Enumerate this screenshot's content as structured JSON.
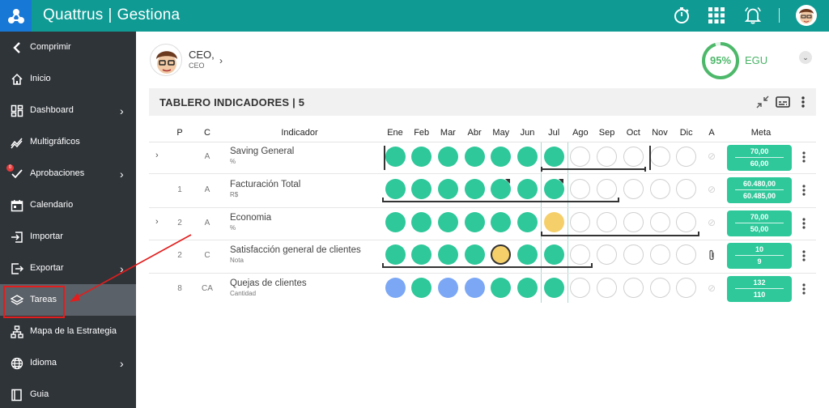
{
  "app": {
    "title_left": "Quattrus",
    "title_right": "Gestiona",
    "title_sep": "|"
  },
  "sidebar": {
    "items": [
      {
        "label": "Comprimir",
        "icon": "chevron-left-icon"
      },
      {
        "label": "Inicio",
        "icon": "home-icon"
      },
      {
        "label": "Dashboard",
        "icon": "dashboard-icon",
        "has_submenu": true
      },
      {
        "label": "Multigráficos",
        "icon": "trend-icon"
      },
      {
        "label": "Aprobaciones",
        "icon": "check-edit-icon",
        "has_submenu": true,
        "badge": "0"
      },
      {
        "label": "Calendario",
        "icon": "calendar-icon"
      },
      {
        "label": "Importar",
        "icon": "import-icon"
      },
      {
        "label": "Exportar",
        "icon": "export-icon",
        "has_submenu": true
      },
      {
        "label": "Tareas",
        "icon": "layers-icon",
        "active": true
      },
      {
        "label": "Mapa de la Estrategia",
        "icon": "sitemap-icon"
      },
      {
        "label": "Idioma",
        "icon": "globe-icon",
        "has_submenu": true
      },
      {
        "label": "Guia",
        "icon": "book-icon"
      }
    ]
  },
  "profile": {
    "name": "CEO,",
    "role": "CEO"
  },
  "score": {
    "percent": "95%",
    "percent_value": 0.95,
    "unit": "EGU",
    "color": "#4db86a"
  },
  "panel": {
    "title": "TABLERO INDICADORES | 5"
  },
  "table": {
    "headers": {
      "p": "P",
      "c": "C",
      "indicador": "Indicador",
      "a": "A",
      "meta": "Meta"
    },
    "months": [
      "Ene",
      "Feb",
      "Mar",
      "Abr",
      "May",
      "Jun",
      "Jul",
      "Ago",
      "Sep",
      "Oct",
      "Nov",
      "Dic"
    ],
    "rows": [
      {
        "p": "",
        "c": "A",
        "name": "Saving General",
        "unit": "%",
        "expandable": true,
        "status": [
          "green",
          "green",
          "green",
          "green",
          "green",
          "green",
          "green",
          "empty",
          "empty",
          "empty",
          "empty",
          "empty"
        ],
        "meta_top": "70,00",
        "meta_bottom": "60,00",
        "attachment": false
      },
      {
        "p": "1",
        "c": "A",
        "name": "Facturación Total",
        "unit": "R$",
        "expandable": false,
        "status": [
          "green",
          "green",
          "green",
          "green",
          "green",
          "green",
          "green",
          "empty",
          "empty",
          "empty",
          "empty",
          "empty"
        ],
        "meta_top": "60.480,00",
        "meta_bottom": "60.485,00",
        "attachment": false
      },
      {
        "p": "2",
        "c": "A",
        "name": "Economia",
        "unit": "%",
        "expandable": true,
        "status": [
          "green",
          "green",
          "green",
          "green",
          "green",
          "green",
          "yellow",
          "empty",
          "empty",
          "empty",
          "empty",
          "empty"
        ],
        "meta_top": "70,00",
        "meta_bottom": "50,00",
        "attachment": false
      },
      {
        "p": "2",
        "c": "C",
        "name": "Satisfacción general de clientes",
        "unit": "Nota",
        "expandable": false,
        "status": [
          "green",
          "green",
          "green",
          "green",
          "yellow",
          "green",
          "green",
          "empty",
          "empty",
          "empty",
          "empty",
          "empty"
        ],
        "meta_top": "10",
        "meta_bottom": "9",
        "attachment": true
      },
      {
        "p": "8",
        "c": "CA",
        "name": "Quejas de clientes",
        "unit": "Cantidad",
        "expandable": false,
        "status": [
          "blue",
          "green",
          "blue",
          "blue",
          "green",
          "green",
          "green",
          "empty",
          "empty",
          "empty",
          "empty",
          "empty"
        ],
        "meta_top": "132",
        "meta_bottom": "110",
        "attachment": false
      }
    ]
  },
  "colors": {
    "topbar": "#0f9b94",
    "sidebar": "#2f3439",
    "green": "#2ec89a",
    "blue": "#7ba7f5",
    "yellow": "#f5cf6a",
    "annotation": "#e21d1d"
  }
}
